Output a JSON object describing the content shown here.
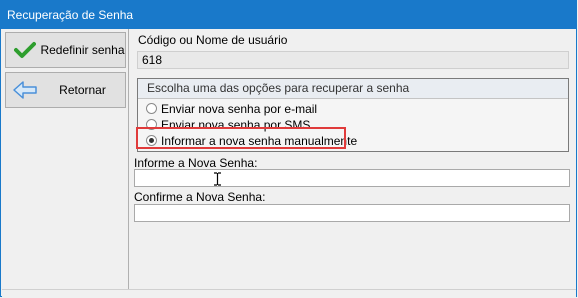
{
  "window": {
    "title": "Recuperação de Senha"
  },
  "toolbar": {
    "save_label": "Redefinir senha",
    "back_label": "Retornar",
    "save_icon": "checkmark-icon",
    "back_icon": "arrow-left-icon"
  },
  "form": {
    "user_label": "Código ou Nome de usuário",
    "user_value": "618",
    "options_title": "Escolha uma das opções para recuperar a senha",
    "options": [
      {
        "label": "Enviar nova senha por e-mail",
        "checked": false
      },
      {
        "label": "Enviar nova senha por SMS",
        "checked": false
      },
      {
        "label": "Informar a nova senha manualmente",
        "checked": true
      }
    ],
    "new_password_label": "Informe a Nova Senha:",
    "new_password_value": "",
    "confirm_password_label": "Confirme a Nova Senha:",
    "confirm_password_value": ""
  },
  "colors": {
    "titlebar": "#1979ca",
    "highlight": "#e03b3b",
    "check_green": "#2e9e2e",
    "arrow_blue": "#4a90d9"
  }
}
